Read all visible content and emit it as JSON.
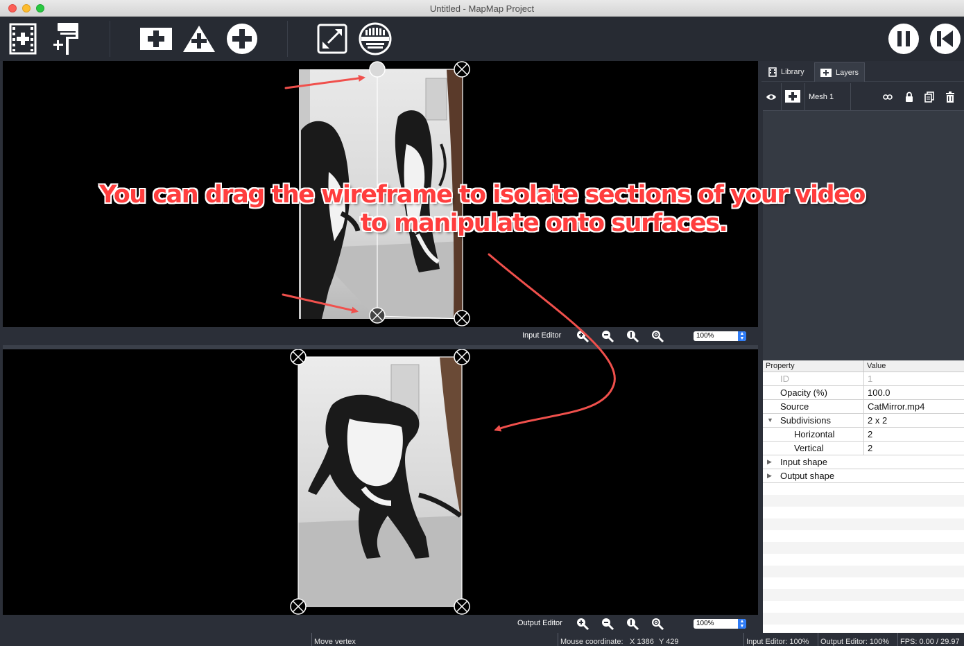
{
  "window": {
    "title": "Untitled - MapMap Project"
  },
  "toolbar": {
    "buttons": [
      {
        "name": "add-video-source-button",
        "icon": "film-add-icon"
      },
      {
        "name": "add-paint-button",
        "icon": "paint-roller-add-icon"
      },
      {
        "name": "add-quad-button",
        "icon": "square-plus-icon"
      },
      {
        "name": "add-triangle-button",
        "icon": "triangle-plus-icon"
      },
      {
        "name": "add-ellipse-button",
        "icon": "circle-plus-icon"
      },
      {
        "name": "fullscreen-button",
        "icon": "fullscreen-icon"
      },
      {
        "name": "test-pattern-button",
        "icon": "test-pattern-icon"
      },
      {
        "name": "pause-button",
        "icon": "pause-icon"
      },
      {
        "name": "rewind-button",
        "icon": "skip-back-icon"
      }
    ]
  },
  "input_editor": {
    "label": "Input Editor",
    "zoom": "100%"
  },
  "output_editor": {
    "label": "Output Editor",
    "zoom": "100%"
  },
  "annotation": {
    "line1": "You can drag the wireframe to isolate sections of your video",
    "line2": "to manipulate onto surfaces.",
    "color": "#ff3d3d"
  },
  "panel": {
    "tabs": [
      {
        "label": "Library",
        "icon": "film-icon"
      },
      {
        "label": "Layers",
        "icon": "square-plus-icon"
      }
    ],
    "layers": [
      {
        "label": "Mesh 1",
        "icons": [
          "eye-icon",
          "mesh-icon",
          "link-icon",
          "lock-icon",
          "duplicate-icon",
          "trash-icon"
        ]
      }
    ]
  },
  "properties": {
    "header": {
      "property": "Property",
      "value": "Value"
    },
    "rows": [
      {
        "key": "ID",
        "value": "1",
        "indent": 1,
        "disabled": true
      },
      {
        "key": "Opacity (%)",
        "value": "100.0",
        "indent": 1
      },
      {
        "key": "Source",
        "value": "CatMirror.mp4",
        "indent": 1
      },
      {
        "key": "Subdivisions",
        "value": "2 x 2",
        "indent": 1,
        "expanded": true
      },
      {
        "key": "Horizontal",
        "value": "2",
        "indent": 2
      },
      {
        "key": "Vertical",
        "value": "2",
        "indent": 2
      },
      {
        "key": "Input shape",
        "value": "",
        "indent": 1,
        "collapsed": true
      },
      {
        "key": "Output shape",
        "value": "",
        "indent": 1,
        "collapsed": true
      }
    ]
  },
  "status": {
    "action": "Move vertex",
    "mouse_label": "Mouse coordinate:",
    "mouse_x": "X 1386",
    "mouse_y": "Y 429",
    "input_zoom": "Input Editor: 100%",
    "output_zoom": "Output Editor: 100%",
    "fps": "FPS: 0.00 / 29.97"
  }
}
